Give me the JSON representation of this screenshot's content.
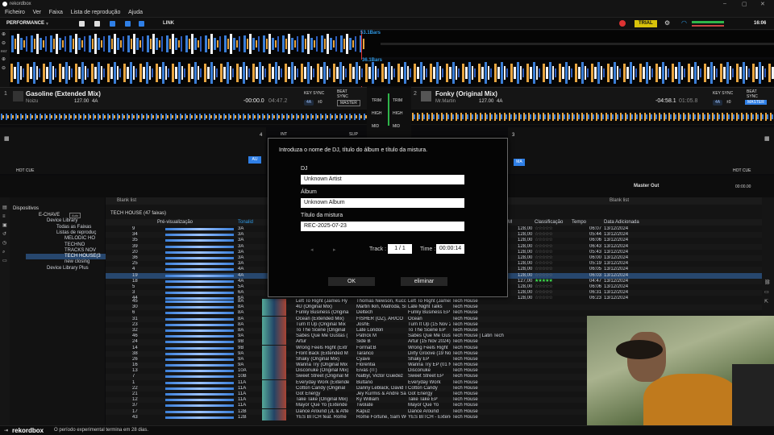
{
  "window": {
    "title": "rekordbox"
  },
  "menu": [
    "Ficheiro",
    "Ver",
    "Faixa",
    "Lista de reprodução",
    "Ajuda"
  ],
  "topbar": {
    "mode": "PERFORMANCE",
    "link": "LINK",
    "trial": "TRIAL",
    "clock": "16:06"
  },
  "waveform": {
    "marker_top": "53.1Bars",
    "marker_bottom": "36.1Bars",
    "rst": "RST"
  },
  "deck1": {
    "number": "1",
    "title": "Gasoline (Extended Mix)",
    "artist": "Noizu",
    "bpm": "127.00",
    "key": "4A",
    "time_elapsed": "-00:00.0",
    "time_total": "04:47.2",
    "key_sync": "KEY SYNC",
    "beat_sync": "BEAT SYNC",
    "master": "MASTER",
    "pitch": "4A",
    "zero": "±0"
  },
  "deck2": {
    "number": "2",
    "title": "Fonky (Original Mix)",
    "artist": "Mr.Martin",
    "bpm": "127.00",
    "key": "4A",
    "time_elapsed": "-04:58.1",
    "time_total": "01:05.8",
    "key_sync": "KEY SYNC",
    "beat_sync": "BEAT SYNC",
    "master": "MASTER",
    "pitch": "4A",
    "zero": "±0"
  },
  "mixer": {
    "trim": "TRIM",
    "high": "HIGH",
    "mid": "MID",
    "master_out": "Master Out",
    "rec_time": "00:00.00",
    "int": "INT",
    "slip": "SLIP",
    "au": "AU",
    "ma": "MA",
    "hot_cue": "HOT CUE",
    "deck4": "4",
    "deck3": "3"
  },
  "sidebar": {
    "header": "Dispositivos",
    "device": "E-CHAVE",
    "device_badge": "Auto",
    "items": [
      "Device Library",
      "Todas as Faixas",
      "Listas de reproduç",
      "MELODIC HO",
      "TECHNO",
      "TRACKS NOV",
      "TECH HOUSE(3",
      "new closing",
      "Device Library Plus"
    ]
  },
  "browser": {
    "left_tab": "Blank list",
    "right_tab": "Blank list",
    "playlist": "TECH HOUSE (47 faixas)",
    "headers": {
      "preview": "Pré-visualização",
      "key": "Tonalid",
      "rating": "Classificação",
      "time": "Tempo",
      "added": "Data Adicionada",
      "m": "M"
    },
    "upper_rows": [
      {
        "n": "9",
        "k": "3A",
        "b": "128,00",
        "t": "06:07",
        "d": "13/12/2024"
      },
      {
        "n": "34",
        "k": "3A",
        "b": "128,00",
        "t": "05:44",
        "d": "13/12/2024"
      },
      {
        "n": "35",
        "k": "3A",
        "b": "128,00",
        "t": "06:06",
        "d": "13/12/2024"
      },
      {
        "n": "39",
        "k": "3A",
        "b": "128,00",
        "t": "06:43",
        "d": "13/12/2024"
      },
      {
        "n": "20",
        "k": "3A",
        "b": "128,00",
        "t": "05:43",
        "d": "13/12/2024"
      },
      {
        "n": "36",
        "k": "3A",
        "b": "128,00",
        "t": "06:00",
        "d": "13/12/2024"
      },
      {
        "n": "25",
        "k": "3A",
        "b": "128,00",
        "t": "05:19",
        "d": "13/12/2024"
      },
      {
        "n": "4",
        "k": "4A",
        "b": "128,00",
        "t": "06:05",
        "d": "13/12/2024"
      },
      {
        "n": "19",
        "k": "4A",
        "b": "128,00",
        "t": "06:03",
        "d": "13/12/2024"
      },
      {
        "n": "18",
        "k": "4A",
        "b": "127,00",
        "t": "04:47",
        "d": "13/12/2024"
      },
      {
        "n": "5",
        "k": "5A",
        "b": "128,00",
        "t": "06:06",
        "d": "13/12/2024"
      },
      {
        "n": "3",
        "k": "6A",
        "b": "128,00",
        "t": "06:31",
        "d": "13/12/2024"
      },
      {
        "n": "44",
        "k": "6A",
        "b": "128,00",
        "t": "06:23",
        "d": "13/12/2024"
      }
    ],
    "lower_rows": [
      {
        "n": "45",
        "k": "8A",
        "title": "Left To Right (James Hy",
        "artist": "Thomas Newson, Kucc",
        "album": "Left To Right (James Hy",
        "genre": "Tech House"
      },
      {
        "n": "30",
        "k": "8A",
        "title": "4U (Original Mix)",
        "artist": "Martin Ikin, Matroda, Sia",
        "album": "Late Night Talks",
        "genre": "Tech House"
      },
      {
        "n": "6",
        "k": "8A",
        "title": "Funky Business (Origina",
        "artist": "Deltech",
        "album": "Funky Business EP (15",
        "genre": "Tech House"
      },
      {
        "n": "31",
        "k": "8A",
        "title": "Ocean (Extended Mix)",
        "artist": "FISHER (OZ), AR/CO",
        "album": "Ocean",
        "genre": "Tech House"
      },
      {
        "n": "23",
        "k": "8A",
        "title": "Turn It Up (Original Mix",
        "artist": "JoshE",
        "album": "Turn It Up (15 Nov 2024)",
        "genre": "Tech House"
      },
      {
        "n": "32",
        "k": "8A",
        "title": "To The Scene (Original",
        "artist": "Late London",
        "album": "To The Scene EP",
        "genre": "Tech House"
      },
      {
        "n": "46",
        "k": "9A",
        "title": "Sabes Que Me Gustas (",
        "artist": "Patrick M",
        "album": "Sabes Que Me Gustas",
        "genre": "Tech House | Latin Tech"
      },
      {
        "n": "24",
        "k": "9B",
        "title": "Artur",
        "artist": "Side B",
        "album": "Artur (15 Nov 2024)",
        "genre": "Tech House"
      },
      {
        "n": "14",
        "k": "9B",
        "title": "Wrong Feels Right (Extr",
        "artist": "Format:B",
        "album": "Wrong Feels Right",
        "genre": "Tech House"
      },
      {
        "n": "38",
        "k": "9A",
        "title": "Front Back (Extended M",
        "artist": "Taranco",
        "album": "Dirty Groove (19 Nov 20",
        "genre": "Tech House"
      },
      {
        "n": "26",
        "k": "9A",
        "title": "Shaky (Original Mix)",
        "artist": "Cyave",
        "album": "Shaky EP",
        "genre": "Tech House"
      },
      {
        "n": "16",
        "k": "9A",
        "title": "Wanna Try (Original Mix",
        "artist": "Florentia",
        "album": "Wanna Try EP (01 Nov",
        "genre": "Tech House"
      },
      {
        "n": "13",
        "k": "10A",
        "title": "Disconuke (Original Mix)",
        "artist": "Eivas (IT)",
        "album": "Disconuke",
        "genre": "Tech House"
      },
      {
        "n": "7",
        "k": "10B",
        "title": "Sweet Street (Original M",
        "artist": "Nalbyl, Victor Guedez",
        "album": "Sweet Street EP",
        "genre": "Tech House"
      },
      {
        "n": "1",
        "k": "11A",
        "title": "Everyday Work (Extende",
        "artist": "Bultano",
        "album": "Everyday Work",
        "genre": "Tech House"
      },
      {
        "n": "22",
        "k": "11A",
        "title": "Cotton Candy (Original",
        "artist": "Danny Leblack, David Ti",
        "album": "Cotton Candy",
        "genre": "Tech House"
      },
      {
        "n": "21",
        "k": "11A",
        "title": "Got Energy",
        "artist": "Jey Kurmis & Andre Sal",
        "album": "Got Energy",
        "genre": "Tech House"
      },
      {
        "n": "12",
        "k": "11A",
        "title": "Take Take (Original Mix)",
        "artist": "Ky William",
        "album": "Take Take EP",
        "genre": "Tech House"
      },
      {
        "n": "37",
        "k": "11A",
        "title": "Mayor Que Yo (Extende",
        "artist": "Twolate",
        "album": "Mayor Que Yo",
        "genre": "Tech House"
      },
      {
        "n": "17",
        "k": "12B",
        "title": "Dance Around (JL & Afte",
        "artist": "Kapuz",
        "album": "Dance Around",
        "genre": "Tech House"
      },
      {
        "n": "43",
        "k": "12B",
        "title": "YES BITCH feat. Rome",
        "artist": "Rome Fortune, Sam WO",
        "album": "YES BITCH - Extended",
        "genre": "Tech House"
      }
    ]
  },
  "dialog": {
    "prompt": "Introduza o nome de DJ, título do álbum e título da mistura.",
    "dj_label": "DJ",
    "dj_value": "Unknown Artist",
    "album_label": "Álbum",
    "album_value": "Unknown Album",
    "mix_label": "Título da mistura",
    "mix_value": "REC-2025-07-23",
    "track_label": "Track :",
    "track_value": "1 / 1",
    "time_label": "Time :",
    "time_value": "00:00:14",
    "ok": "OK",
    "delete": "eliminar"
  },
  "status": {
    "logo": "rekordbox",
    "message": "O período experimental termina em 28 dias."
  },
  "colors": {
    "accent": "#2f7fe6",
    "trial": "#d8c20a",
    "highlight_row": "#27476e",
    "green": "#3ee24e"
  }
}
